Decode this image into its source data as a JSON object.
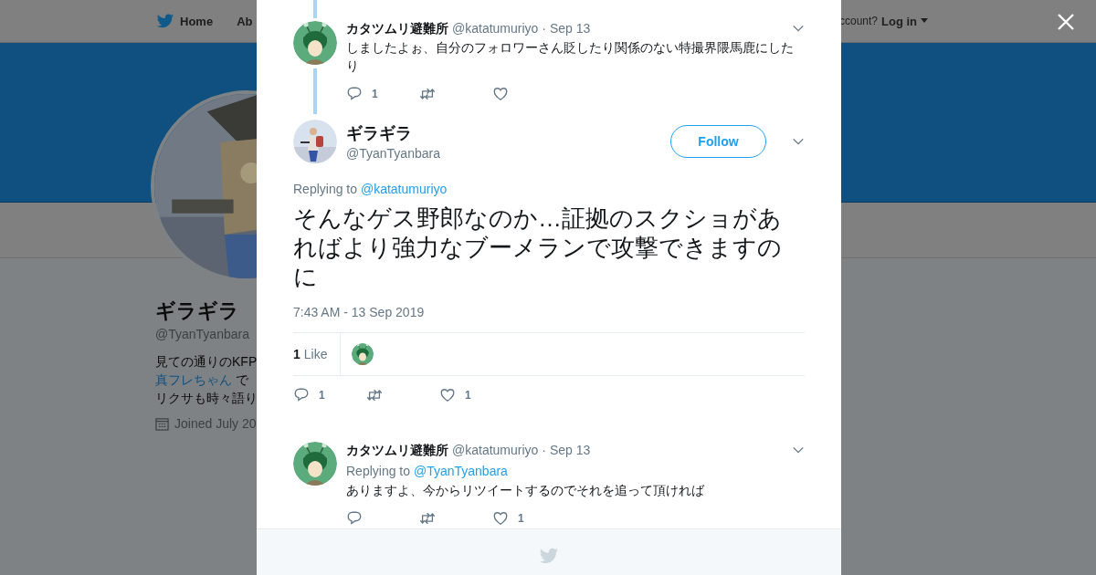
{
  "nav": {
    "items": [
      {
        "label": "Home",
        "kind": "logo"
      },
      {
        "label": "Ab",
        "kind": "plain"
      }
    ],
    "account_prompt": "ccount?",
    "login": "Log in"
  },
  "profile": {
    "name": "ギラギラ",
    "handle": "@TyanTyanbara",
    "bio_lines": [
      {
        "text": "見ての通りのKFP"
      },
      {
        "link": "真フレちゃん",
        "text": "で"
      },
      {
        "text": "リクサも時々語り"
      }
    ],
    "joined": "Joined July 20"
  },
  "tweets": [
    {
      "kind": "reply",
      "thread_line": true,
      "name": "カタツムリ避難所",
      "handle": "@katatumuriyo",
      "date": "· Sep 13",
      "text": "しましたよぉ、自分のフォロワーさん貶したり関係のない特撮界隈馬鹿にしたり",
      "actions": {
        "replies": "1"
      }
    },
    {
      "kind": "focus",
      "name": "ギラギラ",
      "handle": "@TyanTyanbara",
      "follow": "Follow",
      "replying_label": "Replying to",
      "replying_to": "@katatumuriyo",
      "text": "そんなゲス野郎なのか…証拠のスクショがあればより強力なブーメランで攻撃できますのに",
      "timestamp": "7:43 AM - 13 Sep 2019",
      "likes_summary": "**1** Like",
      "actions": {
        "replies": "1",
        "likes": "1"
      }
    },
    {
      "kind": "reply",
      "thread_line": false,
      "name": "カタツムリ避難所",
      "handle": "@katatumuriyo",
      "date": "· Sep 13",
      "replying_label": "Replying to",
      "replying_to": "@TyanTyanbara",
      "text": "ありますよ、今からリツイートするのでそれを追って頂ければ",
      "actions": {
        "likes": "1"
      }
    }
  ]
}
